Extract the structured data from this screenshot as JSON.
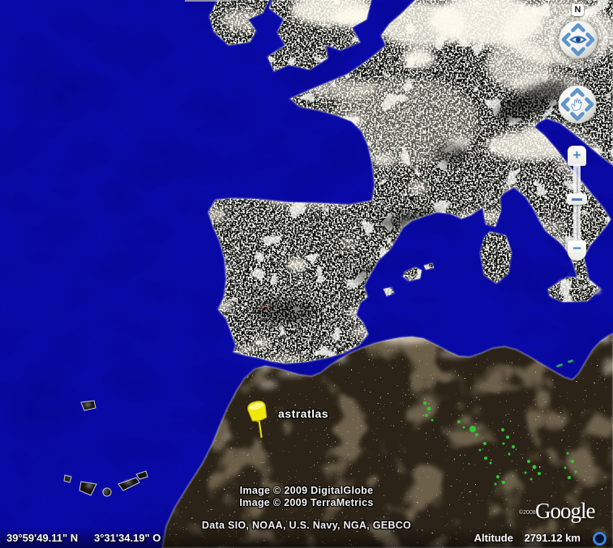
{
  "view": {
    "app": "Google Earth",
    "imagery": "earth-at-night"
  },
  "placemark": {
    "label": "astratlas"
  },
  "controls": {
    "compass_label": "N",
    "zoom_in": "+",
    "zoom_out": "−"
  },
  "attribution": {
    "line1": "Image © 2009 DigitalGlobe",
    "line2": "Image © 2009 TerraMetrics",
    "line3": "Data SIO, NOAA, U.S. Navy, NGA, GEBCO"
  },
  "logo": {
    "text": "Google",
    "copyright": "©2008"
  },
  "status": {
    "latitude": "39°59'49.11\" N",
    "longitude": "3°31'34.19\" O",
    "altitude_label": "Altitude",
    "altitude_value": "2791.12 km"
  },
  "colors": {
    "ocean": "#0a0aa8",
    "land_europe": "#0c0c09",
    "land_africa": "#2b2317",
    "control_accent": "#4a7fc1",
    "pin_yellow": "#f2e70a",
    "vegetation_green": "#2ec82e"
  }
}
